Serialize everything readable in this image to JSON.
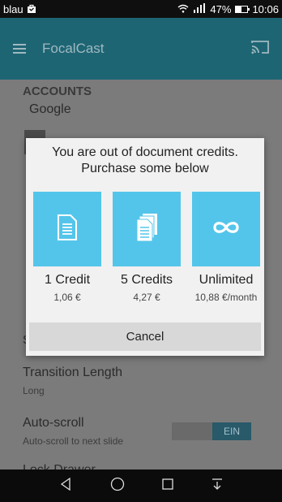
{
  "status_bar": {
    "carrier": "blau",
    "battery_level": "47%",
    "time": "10:06",
    "icons": [
      "notification-bag-icon",
      "wifi-icon",
      "signal-icon",
      "battery-icon"
    ]
  },
  "app_bar": {
    "title": "FocalCast",
    "icons": [
      "hamburger-menu-icon",
      "cast-icon"
    ]
  },
  "settings": {
    "accounts_header": "ACCOUNTS",
    "account_value": "Google",
    "transition_length_title": "Transition Length",
    "transition_length_value": "Long",
    "auto_scroll_title": "Auto-scroll",
    "auto_scroll_sub": "Auto-scroll to next slide",
    "auto_scroll_toggle": "EIN",
    "partial_item": "Lock Drawer",
    "partial_left_letter": "S"
  },
  "dialog": {
    "message_line1": "You are out of document credits.",
    "message_line2": "Purchase some below",
    "options": [
      {
        "label": "1 Credit",
        "price": "1,06 €",
        "icon": "document-icon"
      },
      {
        "label": "5 Credits",
        "price": "4,27 €",
        "icon": "document-stack-icon"
      },
      {
        "label": "Unlimited",
        "price": "10,88 €/month",
        "icon": "infinity-icon"
      }
    ],
    "cancel_label": "Cancel"
  },
  "nav_bar": {
    "icons": [
      "back-icon",
      "home-icon",
      "recents-icon",
      "notification-pulldown-icon"
    ]
  },
  "colors": {
    "tile": "#54c5ea",
    "app_bar_dimmed": "#1e6574",
    "dialog_bg": "#f1f1f1"
  }
}
